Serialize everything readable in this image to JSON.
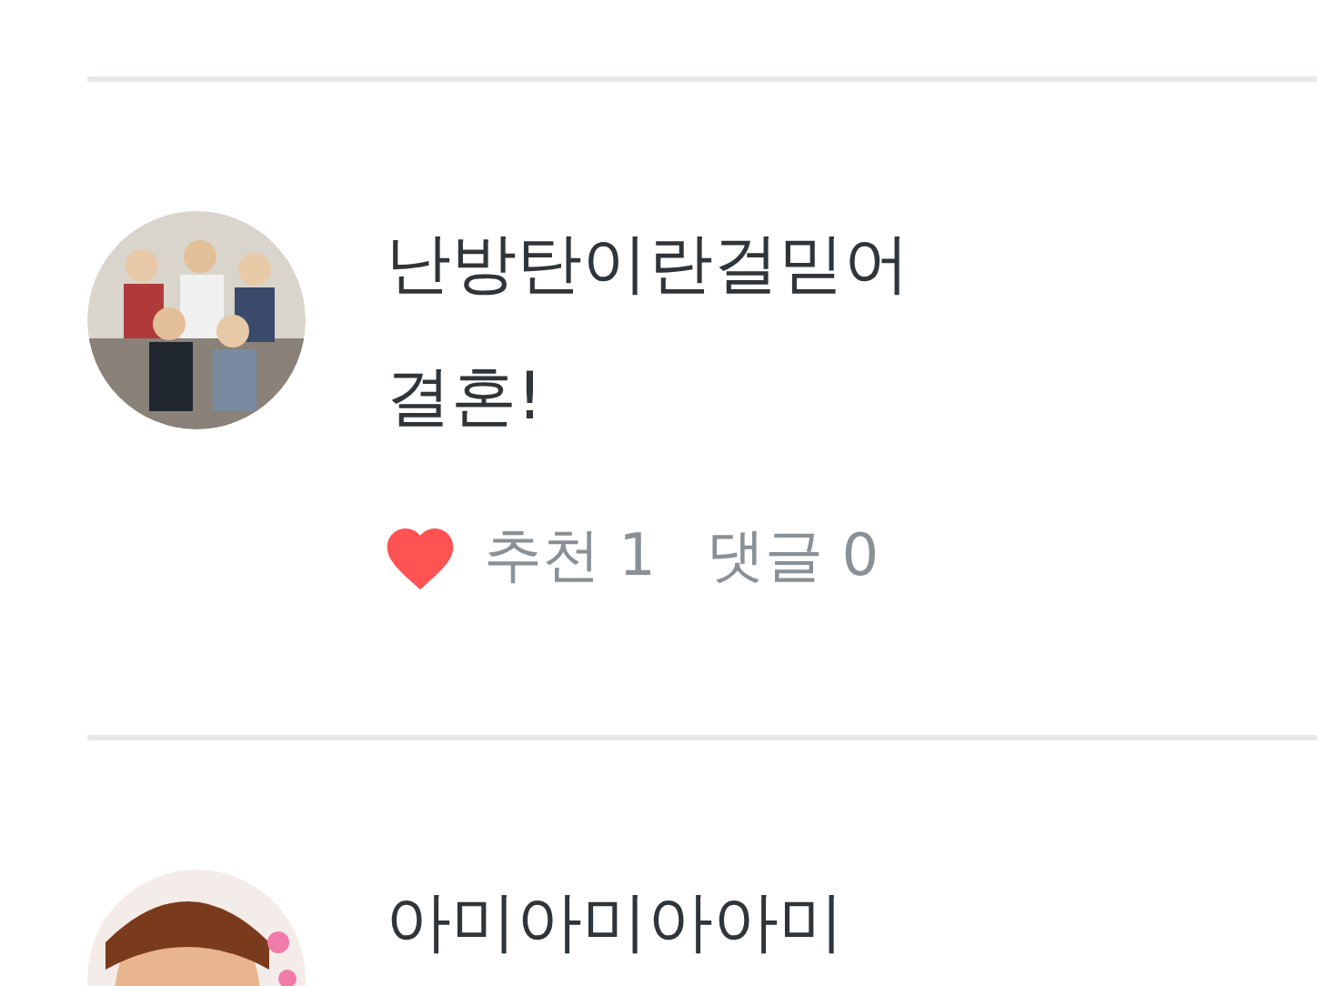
{
  "comments": [
    {
      "author": "난방탄이란걸믿어",
      "text": "결혼!",
      "likes_label": "추천 1",
      "replies_label": "댓글 0"
    },
    {
      "author": "아미아미아아미"
    }
  ]
}
